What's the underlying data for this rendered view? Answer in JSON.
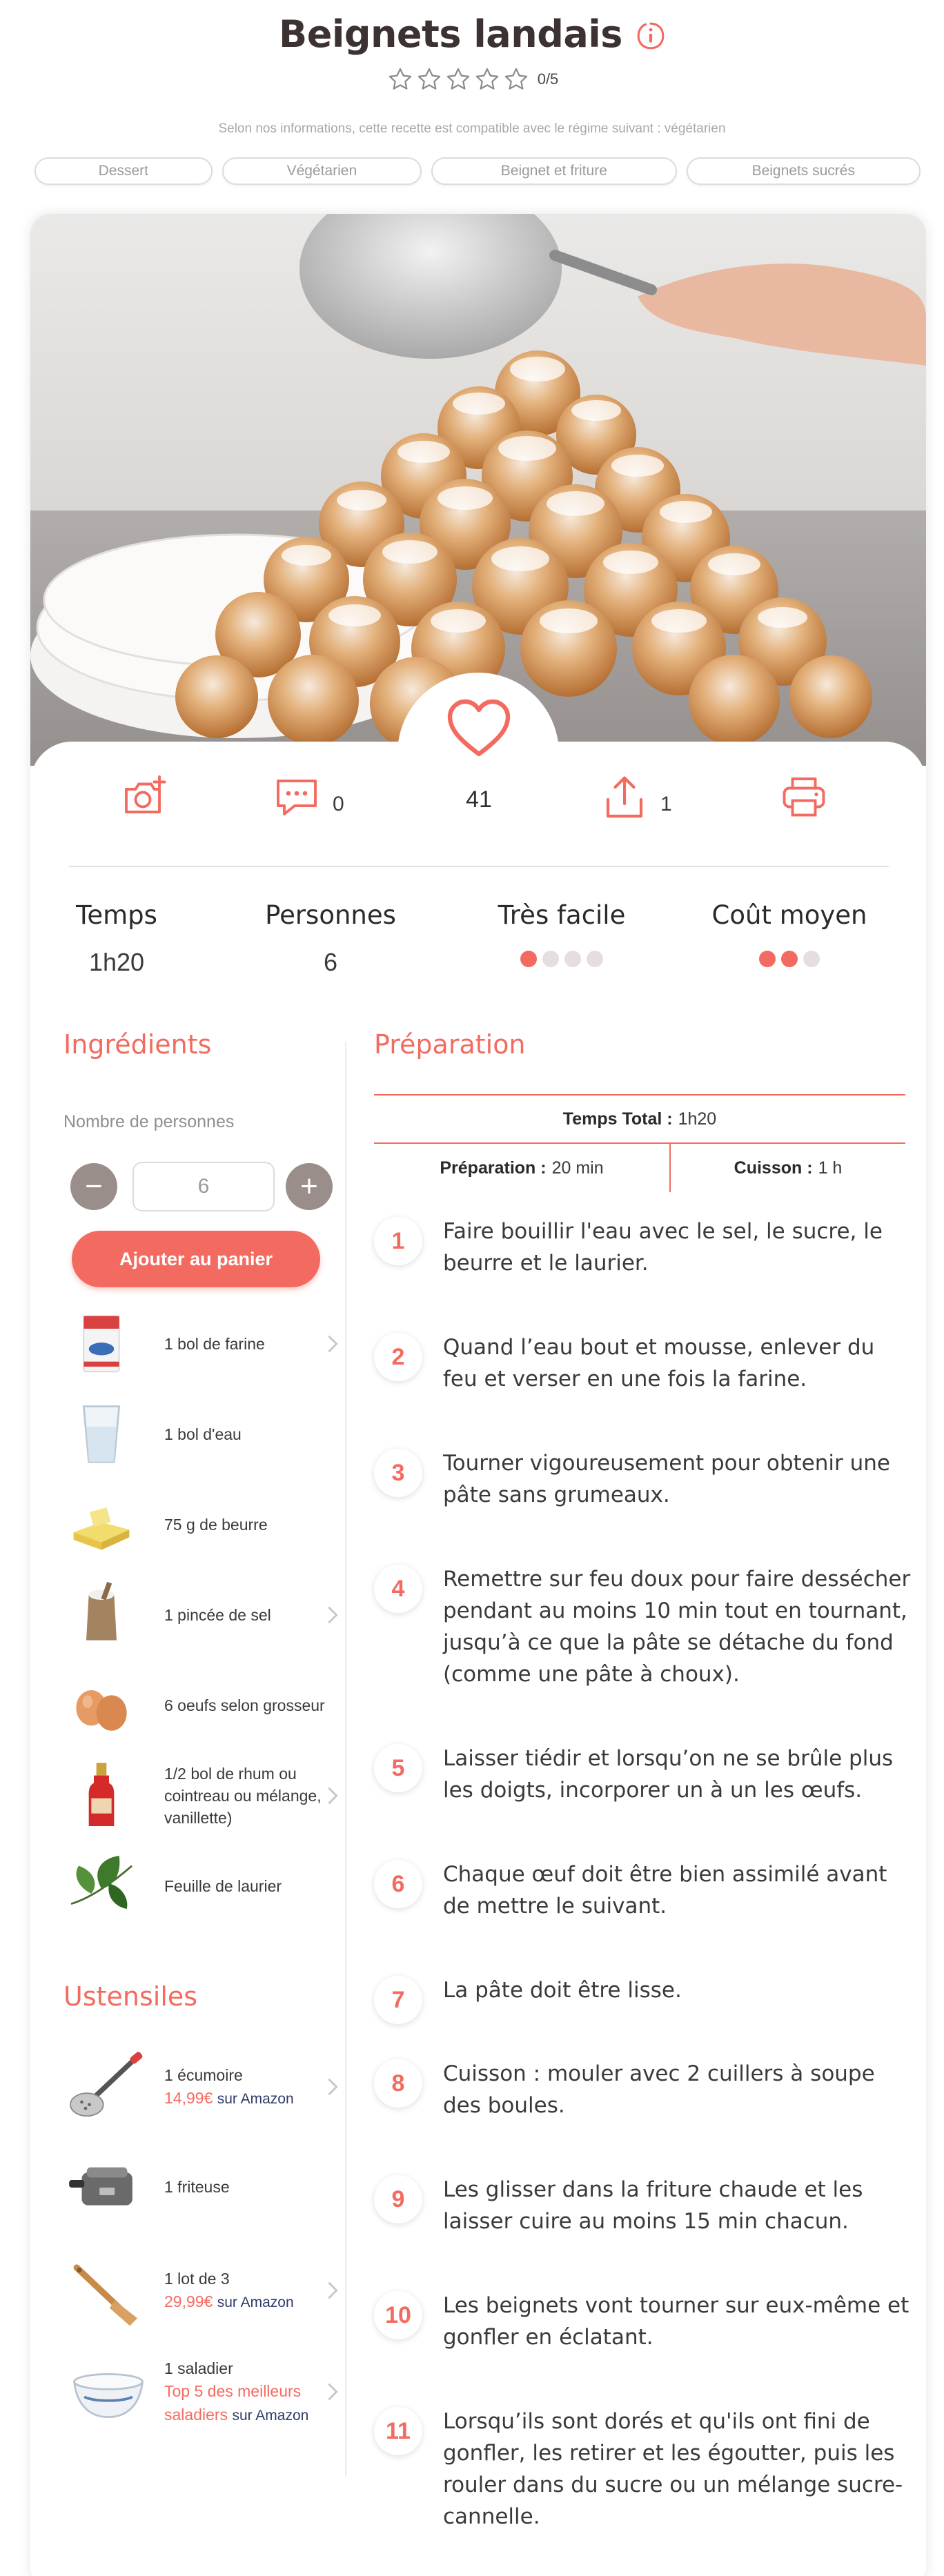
{
  "recipe": {
    "title": "Beignets landais",
    "rating_text": "0/5",
    "compat_note": "Selon nos informations, cette recette est compatible avec le régime suivant : végétarien",
    "tags": [
      "Dessert",
      "Végétarien",
      "Beignet et friture",
      "Beignets sucrés"
    ]
  },
  "actions": {
    "comments_count": "0",
    "likes_count": "41",
    "shares_count": "1"
  },
  "stats": [
    {
      "label": "Temps",
      "value": "1h20"
    },
    {
      "label": "Personnes",
      "value": "6"
    },
    {
      "label": "Très facile",
      "level": 1,
      "max": 4
    },
    {
      "label": "Coût moyen",
      "level": 2,
      "max": 3
    }
  ],
  "ingredients": {
    "title": "Ingrédients",
    "persons_label": "Nombre de personnes",
    "persons_value": "6",
    "minus": "−",
    "plus": "+",
    "cart_button": "Ajouter au panier",
    "items": [
      {
        "text": "1 bol de farine",
        "icon": "flour-icon"
      },
      {
        "text": "1 bol d'eau",
        "icon": "water-glass-icon"
      },
      {
        "text": "75 g de beurre",
        "icon": "butter-icon"
      },
      {
        "text": "1 pincée de sel",
        "icon": "salt-icon"
      },
      {
        "text": "6 oeufs selon grosseur",
        "icon": "eggs-icon"
      },
      {
        "text": "1/2 bol de rhum ou cointreau ou mélange, vanillette)",
        "icon": "rum-bottle-icon"
      },
      {
        "text": "Feuille de laurier",
        "icon": "bay-leaf-icon"
      }
    ]
  },
  "utensils": {
    "title": "Ustensiles",
    "items": [
      {
        "name": "1 écumoire",
        "price": "14,99€",
        "source": "sur Amazon",
        "icon": "skimmer-icon"
      },
      {
        "name": "1 friteuse",
        "icon": "fryer-icon"
      },
      {
        "name": "1 lot de 3",
        "price": "29,99€",
        "source": "sur Amazon",
        "icon": "spatula-icon"
      },
      {
        "name": "1 saladier",
        "link": "Top 5 des meilleurs saladiers",
        "source": "sur Amazon",
        "icon": "bowl-icon"
      }
    ]
  },
  "preparation": {
    "title": "Préparation",
    "total_label": "Temps Total :",
    "total_value": "1h20",
    "prep_label": "Préparation :",
    "prep_value": "20 min",
    "cook_label": "Cuisson :",
    "cook_value": "1 h",
    "steps": [
      {
        "n": "1",
        "text": "Faire bouillir l'eau avec le sel, le sucre, le beurre et le laurier."
      },
      {
        "n": "2",
        "text": "Quand l’eau bout et mousse, enlever du feu et verser en une fois la farine."
      },
      {
        "n": "3",
        "text": "Tourner vigoureusement pour obtenir une pâte sans grumeaux."
      },
      {
        "n": "4",
        "text": "Remettre sur feu doux pour faire dessécher pendant au moins 10 min tout en tournant, jusqu’à ce que la pâte se détache du fond (comme une pâte à choux)."
      },
      {
        "n": "5",
        "text": "Laisser tiédir et lorsqu’on ne se brûle plus les doigts, incorporer un à un les œufs."
      },
      {
        "n": "6",
        "text": "Chaque œuf doit être bien assimilé avant de mettre le suivant."
      },
      {
        "n": "7",
        "text": "La pâte doit être lisse."
      },
      {
        "n": "8",
        "text": "Cuisson : mouler avec 2 cuillers à soupe des boules."
      },
      {
        "n": "9",
        "text": "Les glisser dans la friture chaude et les laisser cuire au moins 15 min chacun."
      },
      {
        "n": "10",
        "text": "Les beignets vont tourner sur eux-même et gonfler en éclatant."
      },
      {
        "n": "11",
        "text": "Lorsqu’ils sont dorés et qu'ils ont fini de gonfler, les retirer et les égoutter, puis les rouler dans du sucre ou un mélange sucre-cannelle."
      }
    ]
  },
  "colors": {
    "accent": "#f36b60",
    "title": "#3d3232",
    "button_grey": "#9a8e8a"
  }
}
